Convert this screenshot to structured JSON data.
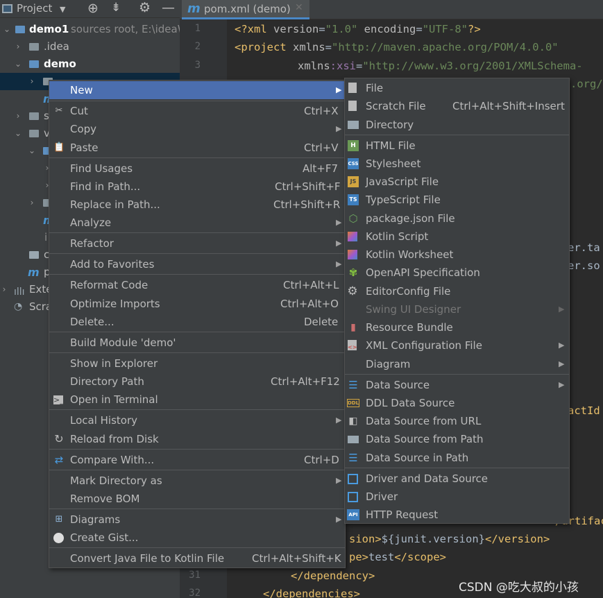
{
  "project_panel": {
    "title": "Project",
    "tree": [
      {
        "label": "demo1",
        "suffix": "sources root,  E:\\ideaW"
      },
      {
        "label": ".idea"
      },
      {
        "label": "demo"
      },
      {
        "label": ""
      },
      {
        "label": "m"
      },
      {
        "label": "s"
      },
      {
        "label": "v"
      },
      {
        "label": ""
      },
      {
        "label": ""
      },
      {
        "label": ""
      },
      {
        "label": ""
      },
      {
        "label": "m"
      },
      {
        "label": "i"
      },
      {
        "label": "c"
      },
      {
        "label": "p"
      },
      {
        "label": "Exte"
      },
      {
        "label": "Scra"
      }
    ]
  },
  "editor": {
    "tab_label": "pom.xml (demo)",
    "line_numbers": [
      "1",
      "2",
      "3",
      "31",
      "32"
    ],
    "lines": {
      "l1_a": "<?xml ",
      "l1_b": "version",
      "l1_c": "=",
      "l1_d": "\"1.0\"",
      "l1_e": " encoding",
      "l1_f": "=",
      "l1_g": "\"UTF-8\"",
      "l1_h": "?>",
      "l2_a": "<project ",
      "l2_b": "xmlns",
      "l2_c": "=",
      "l2_d": "\"http://maven.apache.org/POM/4.0.0\"",
      "l3_a": "xmlns",
      "l3_b": ":xsi",
      "l3_c": "=",
      "l3_d": "\"http://www.w3.org/2001/XMLSchema-",
      "l4": ".org/",
      "r1": "er.ta",
      "r2": "er.so",
      "r3": "actId",
      "l_art": "/artifac",
      "l_ver_a": "sion>",
      "l_ver_b": "${junit.version}",
      "l_ver_c": "</version>",
      "l_scope_a": "pe>",
      "l_scope_b": "test",
      "l_scope_c": "</scope>",
      "l31": "</dependency>",
      "l32": "</dependencies>"
    }
  },
  "context_menu": {
    "items": [
      {
        "label": "New",
        "shortcut": "",
        "submenu": true
      },
      {
        "label": "Cut",
        "shortcut": "Ctrl+X"
      },
      {
        "label": "Copy",
        "shortcut": "",
        "submenu": true
      },
      {
        "label": "Paste",
        "shortcut": "Ctrl+V"
      },
      {
        "label": "Find Usages",
        "shortcut": "Alt+F7"
      },
      {
        "label": "Find in Path...",
        "shortcut": "Ctrl+Shift+F"
      },
      {
        "label": "Replace in Path...",
        "shortcut": "Ctrl+Shift+R"
      },
      {
        "label": "Analyze",
        "shortcut": "",
        "submenu": true
      },
      {
        "label": "Refactor",
        "shortcut": "",
        "submenu": true
      },
      {
        "label": "Add to Favorites",
        "shortcut": "",
        "submenu": true
      },
      {
        "label": "Reformat Code",
        "shortcut": "Ctrl+Alt+L"
      },
      {
        "label": "Optimize Imports",
        "shortcut": "Ctrl+Alt+O"
      },
      {
        "label": "Delete...",
        "shortcut": "Delete"
      },
      {
        "label": "Build Module 'demo'",
        "shortcut": ""
      },
      {
        "label": "Show in Explorer",
        "shortcut": ""
      },
      {
        "label": "Directory Path",
        "shortcut": "Ctrl+Alt+F12"
      },
      {
        "label": "Open in Terminal",
        "shortcut": ""
      },
      {
        "label": "Local History",
        "shortcut": "",
        "submenu": true
      },
      {
        "label": "Reload from Disk",
        "shortcut": ""
      },
      {
        "label": "Compare With...",
        "shortcut": "Ctrl+D"
      },
      {
        "label": "Mark Directory as",
        "shortcut": "",
        "submenu": true
      },
      {
        "label": "Remove BOM",
        "shortcut": ""
      },
      {
        "label": "Diagrams",
        "shortcut": "",
        "submenu": true
      },
      {
        "label": "Create Gist...",
        "shortcut": ""
      },
      {
        "label": "Convert Java File to Kotlin File",
        "shortcut": "Ctrl+Alt+Shift+K"
      }
    ]
  },
  "new_submenu": {
    "items": [
      {
        "label": "File",
        "icon": "file-icon"
      },
      {
        "label": "Scratch File",
        "shortcut": "Ctrl+Alt+Shift+Insert",
        "icon": "scratch-file-icon"
      },
      {
        "label": "Directory",
        "icon": "folder-icon"
      },
      {
        "label": "HTML File",
        "icon": "html-icon",
        "badge": "H"
      },
      {
        "label": "Stylesheet",
        "icon": "css-icon",
        "badge": "CSS"
      },
      {
        "label": "JavaScript File",
        "icon": "js-icon",
        "badge": "JS"
      },
      {
        "label": "TypeScript File",
        "icon": "ts-icon",
        "badge": "TS"
      },
      {
        "label": "package.json File",
        "icon": "nodejs-icon"
      },
      {
        "label": "Kotlin Script",
        "icon": "kotlin-icon"
      },
      {
        "label": "Kotlin Worksheet",
        "icon": "kotlin-icon"
      },
      {
        "label": "OpenAPI Specification",
        "icon": "openapi-icon"
      },
      {
        "label": "EditorConfig File",
        "icon": "gear-icon"
      },
      {
        "label": "Swing UI Designer",
        "icon": "",
        "disabled": true,
        "submenu": true
      },
      {
        "label": "Resource Bundle",
        "icon": "resource-bundle-icon"
      },
      {
        "label": "XML Configuration File",
        "icon": "xml-icon",
        "submenu": true
      },
      {
        "label": "Diagram",
        "icon": "",
        "submenu": true
      },
      {
        "label": "Data Source",
        "icon": "database-icon",
        "submenu": true
      },
      {
        "label": "DDL Data Source",
        "icon": "ddl-icon",
        "badge": "DDL"
      },
      {
        "label": "Data Source from URL",
        "icon": "database-url-icon"
      },
      {
        "label": "Data Source from Path",
        "icon": "folder-open-icon"
      },
      {
        "label": "Data Source in Path",
        "icon": "database-icon"
      },
      {
        "label": "Driver and Data Source",
        "icon": "driver-icon"
      },
      {
        "label": "Driver",
        "icon": "driver-icon"
      },
      {
        "label": "HTTP Request",
        "icon": "api-icon",
        "badge": "API"
      }
    ]
  },
  "watermark": "CSDN @吃大叔的小孩",
  "colors": {
    "highlight": "#4b6eaf",
    "menu_bg": "#3c3f41",
    "editor_bg": "#2b2b2b"
  }
}
